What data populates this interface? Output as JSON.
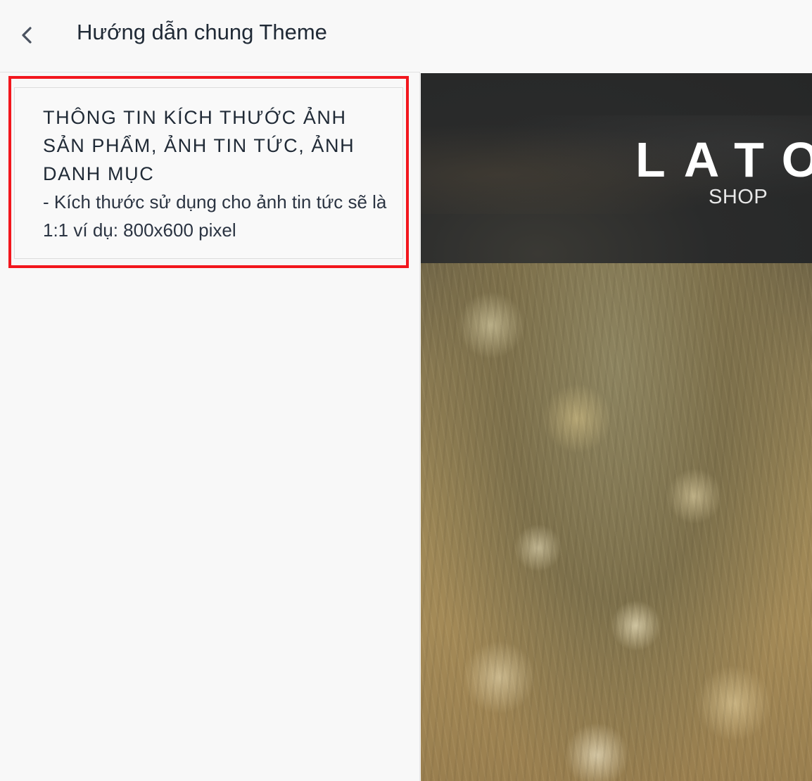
{
  "sidebar": {
    "header": {
      "back_icon": "chevron-left-icon",
      "title": "Hướng dẫn chung Theme"
    },
    "card": {
      "heading": "THÔNG TIN KÍCH THƯỚC ẢNH SẢN PHẨM, ẢNH TIN TỨC, ẢNH DANH MỤC",
      "text": "- Kích thước sử dụng cho ảnh tin tức sẽ là 1:1 ví dụ: 800x600 pixel"
    },
    "highlight_color": "#f2161d"
  },
  "preview": {
    "logo": "LATO",
    "logo_sub": "SHOP"
  }
}
